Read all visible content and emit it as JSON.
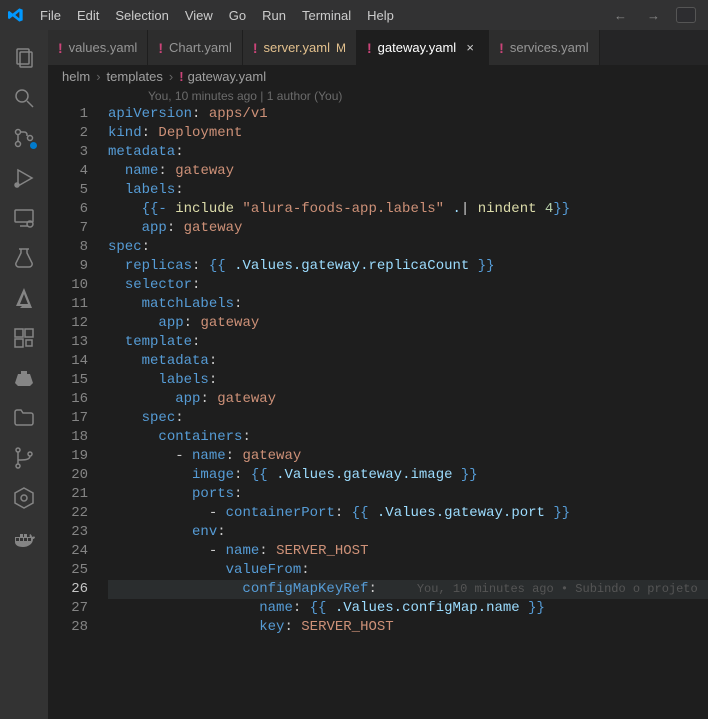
{
  "menu": [
    "File",
    "Edit",
    "Selection",
    "View",
    "Go",
    "Run",
    "Terminal",
    "Help"
  ],
  "tabs": [
    {
      "name": "values.yaml",
      "modified": false,
      "active": false
    },
    {
      "name": "Chart.yaml",
      "modified": false,
      "active": false
    },
    {
      "name": "server.yaml",
      "modified": true,
      "active": false,
      "modifier": "M"
    },
    {
      "name": "gateway.yaml",
      "modified": false,
      "active": true
    },
    {
      "name": "services.yaml",
      "modified": false,
      "active": false
    }
  ],
  "breadcrumb": {
    "parts": [
      "helm",
      "templates",
      "gateway.yaml"
    ]
  },
  "blame_header": "You, 10 minutes ago | 1 author (You)",
  "inline_blame": "You, 10 minutes ago • Subindo o projeto",
  "line_numbers": {
    "start": 1,
    "end": 28,
    "current": 26
  },
  "code": {
    "lines": [
      {
        "n": 1,
        "tokens": [
          [
            "key",
            "apiVersion"
          ],
          [
            "col",
            ": "
          ],
          [
            "str",
            "apps/v1"
          ]
        ]
      },
      {
        "n": 2,
        "tokens": [
          [
            "key",
            "kind"
          ],
          [
            "col",
            ": "
          ],
          [
            "str",
            "Deployment"
          ]
        ]
      },
      {
        "n": 3,
        "tokens": [
          [
            "key",
            "metadata"
          ],
          [
            "col",
            ":"
          ]
        ]
      },
      {
        "n": 4,
        "tokens": [
          [
            "guide",
            "  "
          ],
          [
            "key",
            "name"
          ],
          [
            "col",
            ": "
          ],
          [
            "str",
            "gateway"
          ]
        ]
      },
      {
        "n": 5,
        "tokens": [
          [
            "guide",
            "  "
          ],
          [
            "key",
            "labels"
          ],
          [
            "col",
            ":"
          ]
        ]
      },
      {
        "n": 6,
        "tokens": [
          [
            "guide",
            "    "
          ],
          [
            "tmpl",
            "{{- "
          ],
          [
            "fn",
            "include"
          ],
          [
            "str",
            " \"alura-foods-app.labels\" "
          ],
          [
            "tmplval",
            "."
          ],
          [
            "pipe",
            "| "
          ],
          [
            "fn",
            "nindent "
          ],
          [
            "num",
            "4"
          ],
          [
            "tmpl",
            "}}"
          ]
        ]
      },
      {
        "n": 7,
        "tokens": [
          [
            "guide",
            "    "
          ],
          [
            "key",
            "app"
          ],
          [
            "col",
            ": "
          ],
          [
            "str",
            "gateway"
          ]
        ]
      },
      {
        "n": 8,
        "tokens": [
          [
            "key",
            "spec"
          ],
          [
            "col",
            ":"
          ]
        ]
      },
      {
        "n": 9,
        "tokens": [
          [
            "guide",
            "  "
          ],
          [
            "key",
            "replicas"
          ],
          [
            "col",
            ": "
          ],
          [
            "tmpl",
            "{{ "
          ],
          [
            "tmplval",
            ".Values.gateway.replicaCount"
          ],
          [
            "tmpl",
            " }}"
          ]
        ]
      },
      {
        "n": 10,
        "tokens": [
          [
            "guide",
            "  "
          ],
          [
            "key",
            "selector"
          ],
          [
            "col",
            ":"
          ]
        ]
      },
      {
        "n": 11,
        "tokens": [
          [
            "guide",
            "    "
          ],
          [
            "key",
            "matchLabels"
          ],
          [
            "col",
            ":"
          ]
        ]
      },
      {
        "n": 12,
        "tokens": [
          [
            "guide",
            "      "
          ],
          [
            "key",
            "app"
          ],
          [
            "col",
            ": "
          ],
          [
            "str",
            "gateway"
          ]
        ]
      },
      {
        "n": 13,
        "tokens": [
          [
            "guide",
            "  "
          ],
          [
            "key",
            "template"
          ],
          [
            "col",
            ":"
          ]
        ]
      },
      {
        "n": 14,
        "tokens": [
          [
            "guide",
            "    "
          ],
          [
            "key",
            "metadata"
          ],
          [
            "col",
            ":"
          ]
        ]
      },
      {
        "n": 15,
        "tokens": [
          [
            "guide",
            "      "
          ],
          [
            "key",
            "labels"
          ],
          [
            "col",
            ":"
          ]
        ]
      },
      {
        "n": 16,
        "tokens": [
          [
            "guide",
            "        "
          ],
          [
            "key",
            "app"
          ],
          [
            "col",
            ": "
          ],
          [
            "str",
            "gateway"
          ]
        ]
      },
      {
        "n": 17,
        "tokens": [
          [
            "guide",
            "    "
          ],
          [
            "key",
            "spec"
          ],
          [
            "col",
            ":"
          ]
        ]
      },
      {
        "n": 18,
        "tokens": [
          [
            "guide",
            "      "
          ],
          [
            "key",
            "containers"
          ],
          [
            "col",
            ":"
          ]
        ]
      },
      {
        "n": 19,
        "tokens": [
          [
            "guide",
            "        "
          ],
          [
            "dash",
            "- "
          ],
          [
            "key",
            "name"
          ],
          [
            "col",
            ": "
          ],
          [
            "str",
            "gateway"
          ]
        ]
      },
      {
        "n": 20,
        "tokens": [
          [
            "guide",
            "          "
          ],
          [
            "key",
            "image"
          ],
          [
            "col",
            ": "
          ],
          [
            "tmpl",
            "{{ "
          ],
          [
            "tmplval",
            ".Values.gateway.image"
          ],
          [
            "tmpl",
            " }}"
          ]
        ]
      },
      {
        "n": 21,
        "tokens": [
          [
            "guide",
            "          "
          ],
          [
            "key",
            "ports"
          ],
          [
            "col",
            ":"
          ]
        ]
      },
      {
        "n": 22,
        "tokens": [
          [
            "guide",
            "            "
          ],
          [
            "dash",
            "- "
          ],
          [
            "key",
            "containerPort"
          ],
          [
            "col",
            ": "
          ],
          [
            "tmpl",
            "{{ "
          ],
          [
            "tmplval",
            ".Values.gateway.port"
          ],
          [
            "tmpl",
            " }}"
          ]
        ]
      },
      {
        "n": 23,
        "tokens": [
          [
            "guide",
            "          "
          ],
          [
            "key",
            "env"
          ],
          [
            "col",
            ":"
          ]
        ]
      },
      {
        "n": 24,
        "tokens": [
          [
            "guide",
            "            "
          ],
          [
            "dash",
            "- "
          ],
          [
            "key",
            "name"
          ],
          [
            "col",
            ": "
          ],
          [
            "str",
            "SERVER_HOST"
          ]
        ]
      },
      {
        "n": 25,
        "tokens": [
          [
            "guide",
            "              "
          ],
          [
            "key",
            "valueFrom"
          ],
          [
            "col",
            ":"
          ]
        ]
      },
      {
        "n": 26,
        "tokens": [
          [
            "guide",
            "                "
          ],
          [
            "key",
            "configMapKeyRef"
          ],
          [
            "col",
            ":"
          ]
        ],
        "highlight": true,
        "blame": true
      },
      {
        "n": 27,
        "tokens": [
          [
            "guide",
            "                  "
          ],
          [
            "key",
            "name"
          ],
          [
            "col",
            ": "
          ],
          [
            "tmpl",
            "{{ "
          ],
          [
            "tmplval",
            ".Values.configMap.name"
          ],
          [
            "tmpl",
            " }}"
          ]
        ]
      },
      {
        "n": 28,
        "tokens": [
          [
            "guide",
            "                  "
          ],
          [
            "key",
            "key"
          ],
          [
            "col",
            ": "
          ],
          [
            "str",
            "SERVER_HOST"
          ]
        ]
      }
    ]
  }
}
